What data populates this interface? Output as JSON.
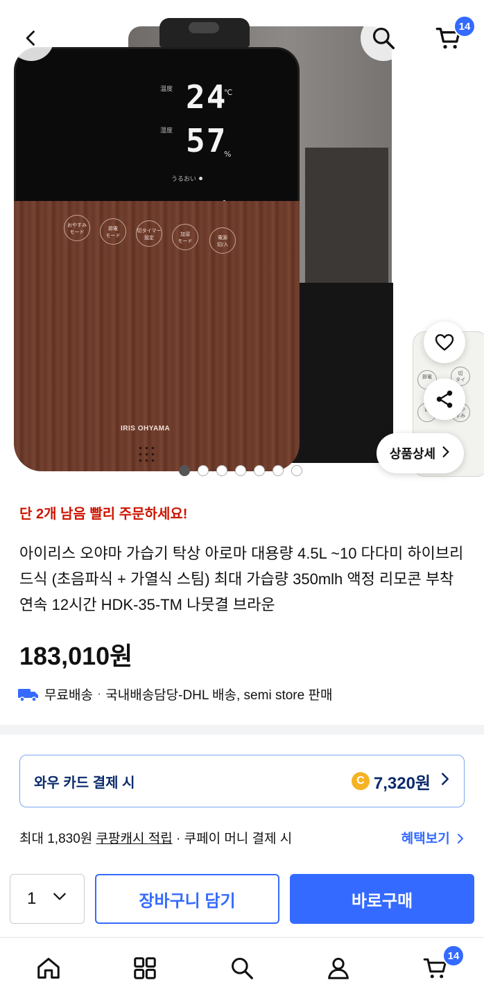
{
  "header": {
    "cart_count": "14"
  },
  "product_image": {
    "display": {
      "temp_label": "温度",
      "temp_value": "24",
      "temp_unit": "℃",
      "humid_label": "湿度",
      "humid_value": "57",
      "humid_unit": "%",
      "uruoi_label": "うるおい"
    },
    "buttons": [
      "おやすみ\nモード",
      "節電\nモード",
      "切タイマー\n設定",
      "加湿\nモード",
      "電源\n切/入"
    ],
    "brand": "IRIS OHYAMA",
    "remote_buttons": [
      "節電",
      "切\nタイ",
      "節",
      "おや\nすみ"
    ],
    "detail_label": "상품상세",
    "slide_count": 7,
    "active_slide": 0
  },
  "product": {
    "stock_notice": "단 2개 남음 빨리 주문하세요!",
    "title": "아이리스 오야마 가습기 탁상 아로마 대용량 4.5L ~10 다다미 하이브리드식 (초음파식 + 가열식 스팀) 최대 가습량 350mlh 액정 리모콘 부착 연속 12시간 HDK-35-TM 나뭇결 브라운",
    "price": "183,010원",
    "shipping": {
      "free": "무료배송",
      "separator": "·",
      "detail": "국내배송담당-DHL 배송, semi store 판매"
    }
  },
  "benefit_card": {
    "label": "와우 카드 결제 시",
    "coin_symbol": "C",
    "amount": "7,320원"
  },
  "benefit_line": {
    "prefix": "최대 1,830원 ",
    "underlined": "쿠팡캐시 적립",
    "suffix": " · 쿠페이 머니 결제 시",
    "link": "혜택보기"
  },
  "purchase": {
    "quantity": "1",
    "add_to_cart": "장바구니 담기",
    "buy_now": "바로구매"
  },
  "bottom_nav": {
    "cart_count": "14"
  },
  "colors": {
    "accent": "#346aff",
    "stock_red": "#cb1400",
    "card_border": "#7ba6f0",
    "coin": "#f5b324"
  }
}
